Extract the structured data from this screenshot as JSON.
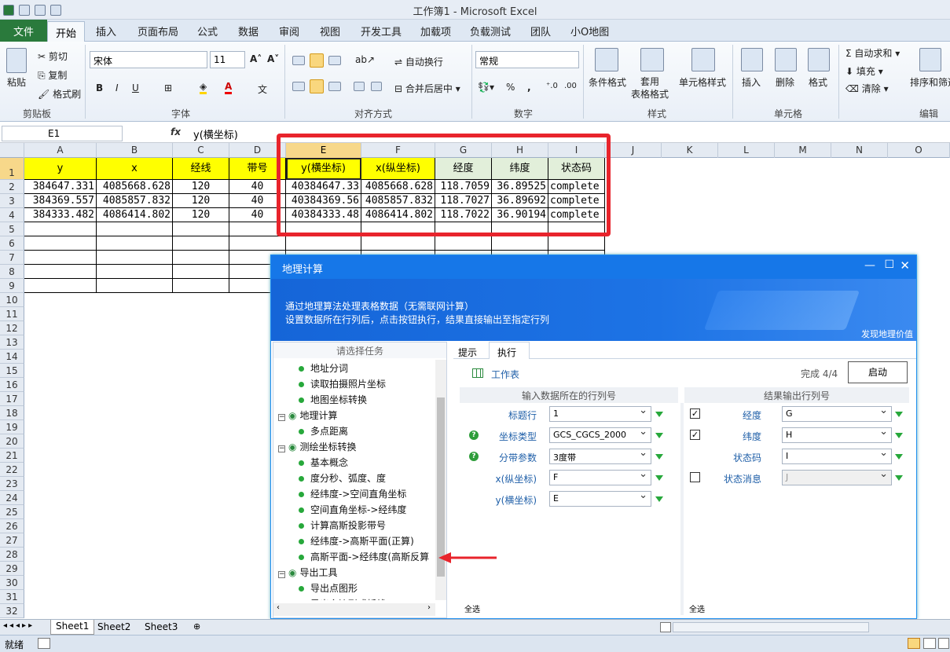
{
  "window": {
    "title": "工作簿1 - Microsoft Excel"
  },
  "ribbon_tabs": [
    "文件",
    "开始",
    "插入",
    "页面布局",
    "公式",
    "数据",
    "审阅",
    "视图",
    "开发工具",
    "加载项",
    "负载测试",
    "团队",
    "小O地图"
  ],
  "ribbon": {
    "clipboard": {
      "paste": "粘贴",
      "cut": "剪切",
      "copy": "复制",
      "format_painter": "格式刷",
      "label": "剪贴板"
    },
    "font": {
      "name": "宋体",
      "size": "11",
      "bold": "B",
      "italic": "I",
      "underline": "U",
      "label": "字体"
    },
    "alignment": {
      "wrap": "自动换行",
      "merge": "合并后居中",
      "label": "对齐方式"
    },
    "number": {
      "format": "常规",
      "label": "数字"
    },
    "styles": {
      "conditional": "条件格式",
      "table": "套用\n表格格式",
      "cell_styles": "单元格样式",
      "label": "样式"
    },
    "cells": {
      "insert": "插入",
      "delete": "删除",
      "format": "格式",
      "label": "单元格"
    },
    "editing": {
      "autosum": "自动求和",
      "fill": "填充",
      "clear": "清除",
      "sort": "排序和筛选",
      "label": "编辑"
    }
  },
  "formula_bar": {
    "name_box": "E1",
    "fx": "fx",
    "content": "y(横坐标)"
  },
  "columns": [
    "A",
    "B",
    "C",
    "D",
    "E",
    "F",
    "G",
    "H",
    "I",
    "J",
    "K",
    "L",
    "M",
    "N",
    "O"
  ],
  "rows": [
    "1",
    "2",
    "3",
    "4",
    "5",
    "6",
    "7",
    "8",
    "9",
    "10",
    "11",
    "12",
    "13",
    "14",
    "15",
    "16",
    "17",
    "18",
    "19",
    "20",
    "21",
    "22",
    "23",
    "24",
    "25",
    "26",
    "27",
    "28",
    "29",
    "30",
    "31",
    "32"
  ],
  "table": {
    "headers": [
      "y",
      "x",
      "经线",
      "带号",
      "y(横坐标)",
      "x(纵坐标)",
      "经度",
      "纬度",
      "状态码"
    ],
    "data": [
      [
        "384647.331",
        "4085668.628",
        "120",
        "40",
        "40384647.33",
        "4085668.628",
        "118.7059",
        "36.89525",
        "complete"
      ],
      [
        "384369.557",
        "4085857.832",
        "120",
        "40",
        "40384369.56",
        "4085857.832",
        "118.7027",
        "36.89692",
        "complete"
      ],
      [
        "384333.482",
        "4086414.802",
        "120",
        "40",
        "40384333.48",
        "4086414.802",
        "118.7022",
        "36.90194",
        "complete"
      ]
    ]
  },
  "dialog": {
    "title": "地理计算",
    "banner_line1": "通过地理算法处理表格数据（无需联网计算）",
    "banner_line2": "设置数据所在行列后，点击按钮执行，结果直接输出至指定行列",
    "banner_tagline": "发现地理价值",
    "left_header": "请选择任务",
    "tree": [
      {
        "label": "地址分词",
        "level": 2
      },
      {
        "label": "读取拍摄照片坐标",
        "level": 2
      },
      {
        "label": "地图坐标转换",
        "level": 2
      },
      {
        "label": "地理计算",
        "level": 1
      },
      {
        "label": "多点距离",
        "level": 2
      },
      {
        "label": "测绘坐标转换",
        "level": 1
      },
      {
        "label": "基本概念",
        "level": 2
      },
      {
        "label": "度分秒、弧度、度",
        "level": 2
      },
      {
        "label": "经纬度->空间直角坐标",
        "level": 2
      },
      {
        "label": "空间直角坐标->经纬度",
        "level": 2
      },
      {
        "label": "计算高斯投影带号",
        "level": 2
      },
      {
        "label": "经纬度->高斯平面(正算)",
        "level": 2
      },
      {
        "label": "高斯平面->经纬度(高斯反算",
        "level": 2
      },
      {
        "label": "导出工具",
        "level": 1
      },
      {
        "label": "导出点图形",
        "level": 2
      },
      {
        "label": "导出多边形或折线",
        "level": 2
      }
    ],
    "tabs": [
      "提示",
      "执行"
    ],
    "worksheet_label": "工作表",
    "progress": "完成 4/4",
    "start_button": "启动",
    "input_header": "输入数据所在的行列号",
    "output_header": "结果输出行列号",
    "inputs": [
      {
        "label": "标题行",
        "value": "1",
        "help": false
      },
      {
        "label": "坐标类型",
        "value": "GCS_CGCS_2000",
        "help": true
      },
      {
        "label": "分带参数",
        "value": "3度带",
        "help": true
      },
      {
        "label": "x(纵坐标)",
        "value": "F",
        "help": false
      },
      {
        "label": "y(横坐标)",
        "value": "E",
        "help": false
      }
    ],
    "outputs": [
      {
        "label": "经度",
        "value": "G",
        "checked": true,
        "checkbox": true
      },
      {
        "label": "纬度",
        "value": "H",
        "checked": true,
        "checkbox": true
      },
      {
        "label": "状态码",
        "value": "I",
        "checked": false,
        "checkbox": false
      },
      {
        "label": "状态消息",
        "value": "J",
        "checked": false,
        "checkbox": true,
        "disabled": true
      }
    ],
    "select_all": "全选"
  },
  "sheet_tabs": [
    "Sheet1",
    "Sheet2",
    "Sheet3"
  ],
  "status": {
    "ready": "就绪"
  },
  "colors": {
    "accent": "#1677e8",
    "highlight": "#e8242c",
    "header_yellow": "#ffff00",
    "header_green": "#e2efda"
  }
}
